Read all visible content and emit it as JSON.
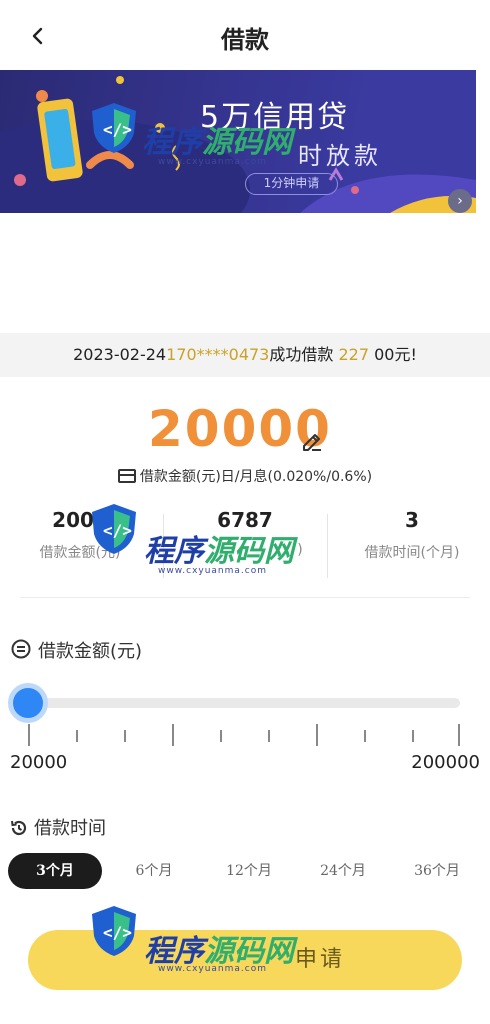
{
  "header": {
    "title": "借款",
    "back_icon": "chevron-left-icon"
  },
  "banner": {
    "title": "5万信用贷",
    "subtitle": "时放款",
    "pill": "1分钟申请",
    "next_icon": "chevron-right-icon"
  },
  "notice": {
    "date": "2023-02-24",
    "phone": "170****0473",
    "mid": "成功借款",
    "amount": "227",
    "tail": "00元!"
  },
  "loan": {
    "amount": "20000",
    "rate_label": "借款金额(元)日/月息(0.020%/0.6%)"
  },
  "stats": [
    {
      "value": "2000",
      "label": "借款金额(元)"
    },
    {
      "value": "6787",
      "label": ")"
    },
    {
      "value": "3",
      "label": "借款时间(个月)"
    }
  ],
  "amount_section": {
    "title": "借款金额(元)",
    "min": "20000",
    "max": "200000",
    "slider_fraction": 0.0
  },
  "term_section": {
    "title": "借款时间",
    "options": [
      "3个月",
      "6个月",
      "12个月",
      "24个月",
      "36个月"
    ],
    "selected": "3个月"
  },
  "apply_button": {
    "label": "申请"
  },
  "watermark": {
    "text_a": "程序",
    "text_b": "源码网",
    "url": "www.cxyuanma.com"
  },
  "colors": {
    "accent_orange": "#f0913a",
    "slider_blue": "#2f86f5",
    "button_yellow": "#f7d85a",
    "notice_gold": "#c9a227"
  }
}
